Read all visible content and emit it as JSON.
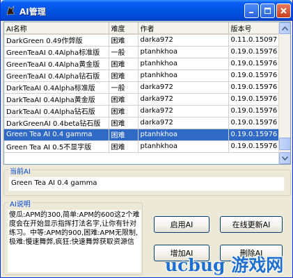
{
  "window": {
    "title": "AI管理"
  },
  "table": {
    "columns": [
      "AI名称",
      "难度",
      "作者",
      "版本号"
    ],
    "rows": [
      {
        "name": "DarkGreen 0.49作弊版",
        "difficulty": "困难",
        "author": "darka972",
        "version": "0.11.0.15097"
      },
      {
        "name": "GreenTeaAI 0.4Alpha标准版",
        "difficulty": "一般",
        "author": "ptanhkhoa",
        "version": "0.19.0.15976"
      },
      {
        "name": "GreenTeaAI 0.4Alpha黄金版",
        "difficulty": "困难",
        "author": "ptanhkhoa",
        "version": "0.19.0.15976"
      },
      {
        "name": "GreenTeaAI 0.4Alpha钻石版",
        "difficulty": "困难",
        "author": "ptanhkhoa",
        "version": "0.19.0.15976"
      },
      {
        "name": "DarkTeaAI 0.4Alpha标准版",
        "difficulty": "一般",
        "author": "darka972",
        "version": "0.19.0.15976"
      },
      {
        "name": "DarkTeaAI 0.4Alpha黄金版",
        "difficulty": "困难",
        "author": "darka972",
        "version": "0.19.0.15976"
      },
      {
        "name": "DarkTeaAI 0.4Alpha钻石版",
        "difficulty": "困难",
        "author": "darka972",
        "version": "0.19.0.15976"
      },
      {
        "name": "DarkGreenAI 0.4beta钻石版",
        "difficulty": "困难",
        "author": "darka972",
        "version": "0.19.0.15976"
      },
      {
        "name": "Green Tea AI 0.4 gamma",
        "difficulty": "困难",
        "author": "ptanhkhoa",
        "version": "0.19.0.15976",
        "selected": true
      },
      {
        "name": "Green Tea AI 0.5不显字版",
        "difficulty": "困难",
        "author": "ptanhkhoa",
        "version": "0.19.0.15976"
      }
    ]
  },
  "current": {
    "label": "当前AI",
    "value": "Green Tea AI 0.4 gamma"
  },
  "description": {
    "label": "AI说明",
    "text": "傻瓜:APM的300,简单:APM的600这2个难度会在开始显示指挥打法名字,让你有针对练习。中等:APM的900,困难:APM无限制,极难:慢速舞弊,疯狂:快速舞弊获取资源信"
  },
  "buttons": {
    "enable": "启用AI",
    "update": "在线更新AI",
    "add": "增加AI",
    "delete": "删除AI"
  },
  "watermark": {
    "text": "ucbug 游戏网"
  },
  "colors": {
    "selection": "#316ac5",
    "titlebar": "#0054e3",
    "group_label": "#0046d5"
  }
}
